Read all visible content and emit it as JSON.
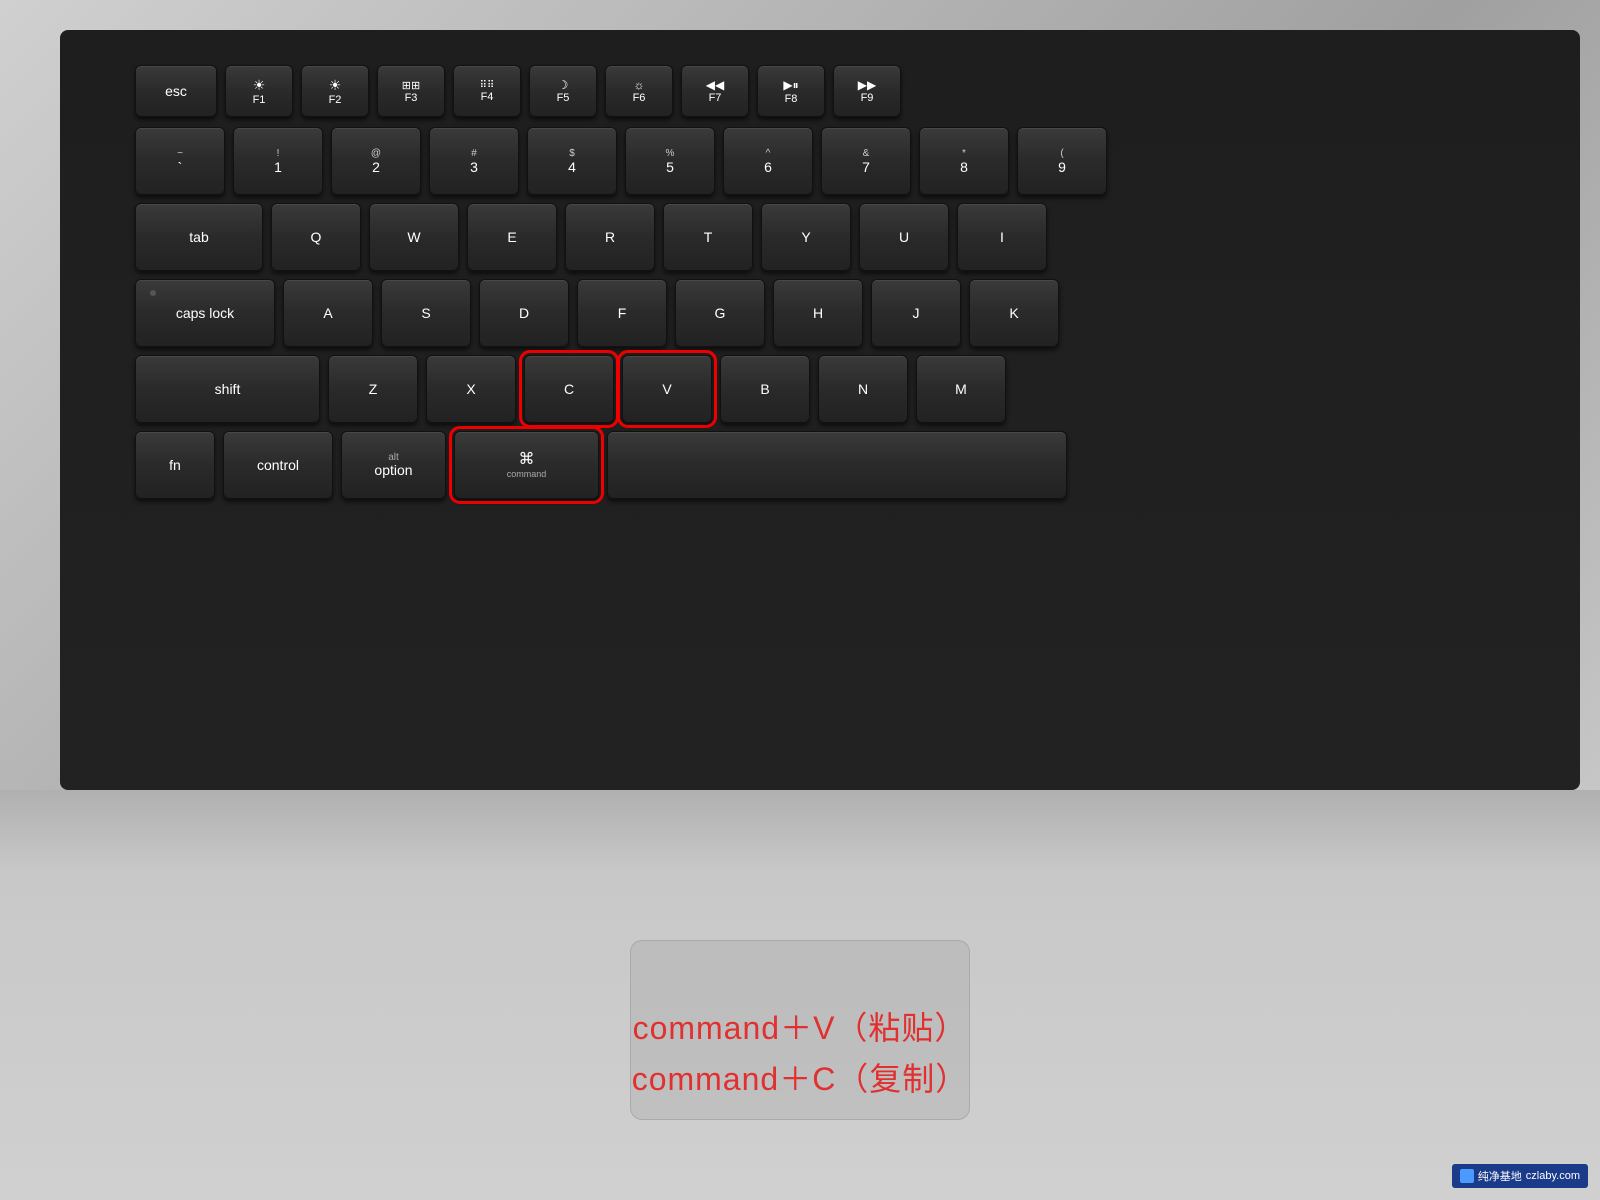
{
  "keyboard": {
    "background_color": "#1e1e1e",
    "silver_color": "#c0c0c0",
    "rows": {
      "fn_row": {
        "keys": [
          "esc",
          "F1",
          "F2",
          "F3",
          "F4",
          "F5",
          "F6",
          "F7",
          "F8"
        ]
      },
      "number_row": {
        "keys": [
          "~`",
          "!1",
          "@2",
          "#3",
          "$4",
          "%5",
          "^6",
          "&7",
          "*8",
          "(9"
        ]
      },
      "qwerty_row": {
        "keys": [
          "tab",
          "Q",
          "W",
          "E",
          "R",
          "T",
          "Y",
          "U",
          "I"
        ]
      },
      "asdf_row": {
        "keys": [
          "caps lock",
          "A",
          "S",
          "D",
          "F",
          "G",
          "H",
          "J",
          "K"
        ]
      },
      "zxcv_row": {
        "keys": [
          "shift",
          "Z",
          "X",
          "C",
          "V",
          "B",
          "N",
          "M"
        ]
      },
      "bottom_row": {
        "keys": [
          "fn",
          "control",
          "alt option",
          "⌘ command",
          "space"
        ]
      }
    },
    "highlighted_keys": [
      "C",
      "V",
      "command"
    ],
    "annotation_line1": "command＋V（粘贴）",
    "annotation_line2": "command＋C（复制）"
  },
  "watermark": {
    "icon": "🔷",
    "text": "纯净基地",
    "url_text": "czlaby.com"
  }
}
